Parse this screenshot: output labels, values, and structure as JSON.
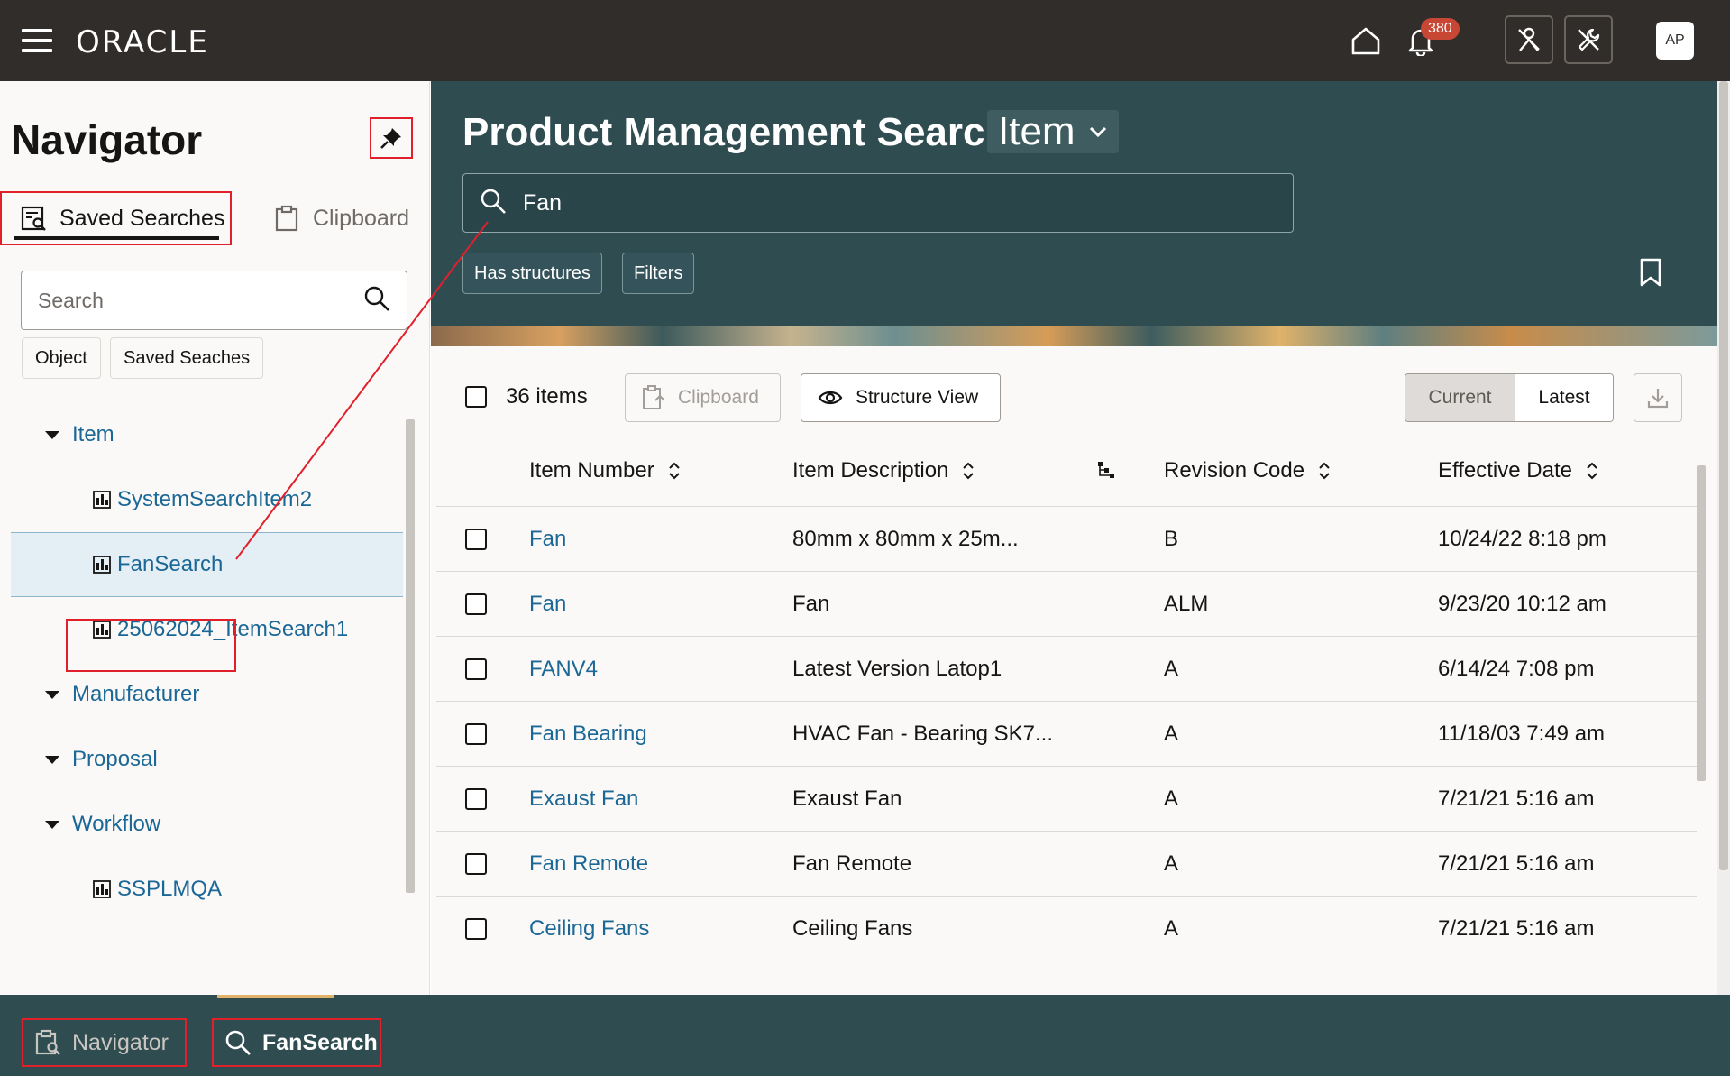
{
  "topbar": {
    "logo": "ORACLE",
    "notification_count": "380",
    "avatar_initials": "AP"
  },
  "navigator": {
    "title": "Navigator",
    "tabs": [
      {
        "label": "Saved Searches",
        "active": true
      },
      {
        "label": "Clipboard",
        "active": false
      }
    ],
    "search_placeholder": "Search",
    "filter_chips": [
      "Object",
      "Saved Seaches"
    ],
    "tree": [
      {
        "label": "Item",
        "type": "group"
      },
      {
        "label": "SystemSearchItem2",
        "type": "leaf"
      },
      {
        "label": "FanSearch",
        "type": "leaf",
        "selected": true
      },
      {
        "label": "25062024_ItemSearch1",
        "type": "leaf"
      },
      {
        "label": "Manufacturer",
        "type": "group"
      },
      {
        "label": "Proposal",
        "type": "group"
      },
      {
        "label": "Workflow",
        "type": "group"
      },
      {
        "label": "SSPLMQA",
        "type": "leaf"
      }
    ]
  },
  "hero": {
    "title": "Product Management Search",
    "object_type": "Item",
    "search_value": "Fan",
    "chips": [
      "Has structures",
      "Filters"
    ]
  },
  "toolbar": {
    "items_count": "36 items",
    "clipboard_label": "Clipboard",
    "structure_view_label": "Structure View",
    "segment": [
      "Current",
      "Latest"
    ],
    "segment_selected": "Current"
  },
  "table": {
    "columns": [
      "Item Number",
      "Item Description",
      "Revision Code",
      "Effective Date"
    ],
    "rows": [
      {
        "number": "Fan",
        "description": "80mm x 80mm x 25m...",
        "revision": "B",
        "date": "10/24/22 8:18 pm"
      },
      {
        "number": "Fan",
        "description": "Fan",
        "revision": "ALM",
        "date": "9/23/20 10:12 am"
      },
      {
        "number": "FANV4",
        "description": "Latest Version Latop1",
        "revision": "A",
        "date": "6/14/24 7:08 pm"
      },
      {
        "number": "Fan Bearing",
        "description": "HVAC Fan - Bearing SK7...",
        "revision": "A",
        "date": "11/18/03 7:49 am"
      },
      {
        "number": "Exaust Fan",
        "description": "Exaust Fan",
        "revision": "A",
        "date": "7/21/21 5:16 am"
      },
      {
        "number": "Fan Remote",
        "description": "Fan Remote",
        "revision": "A",
        "date": "7/21/21 5:16 am"
      },
      {
        "number": "Ceiling Fans",
        "description": "Ceiling Fans",
        "revision": "A",
        "date": "7/21/21 5:16 am"
      }
    ]
  },
  "bottombar": {
    "items": [
      {
        "label": "Navigator",
        "icon": "navigator-icon"
      },
      {
        "label": "FanSearch",
        "icon": "search-icon"
      }
    ]
  },
  "colors": {
    "topbar": "#312d2a",
    "hero": "#2f4d51",
    "link": "#1b6796",
    "annotation": "#e0202a"
  }
}
